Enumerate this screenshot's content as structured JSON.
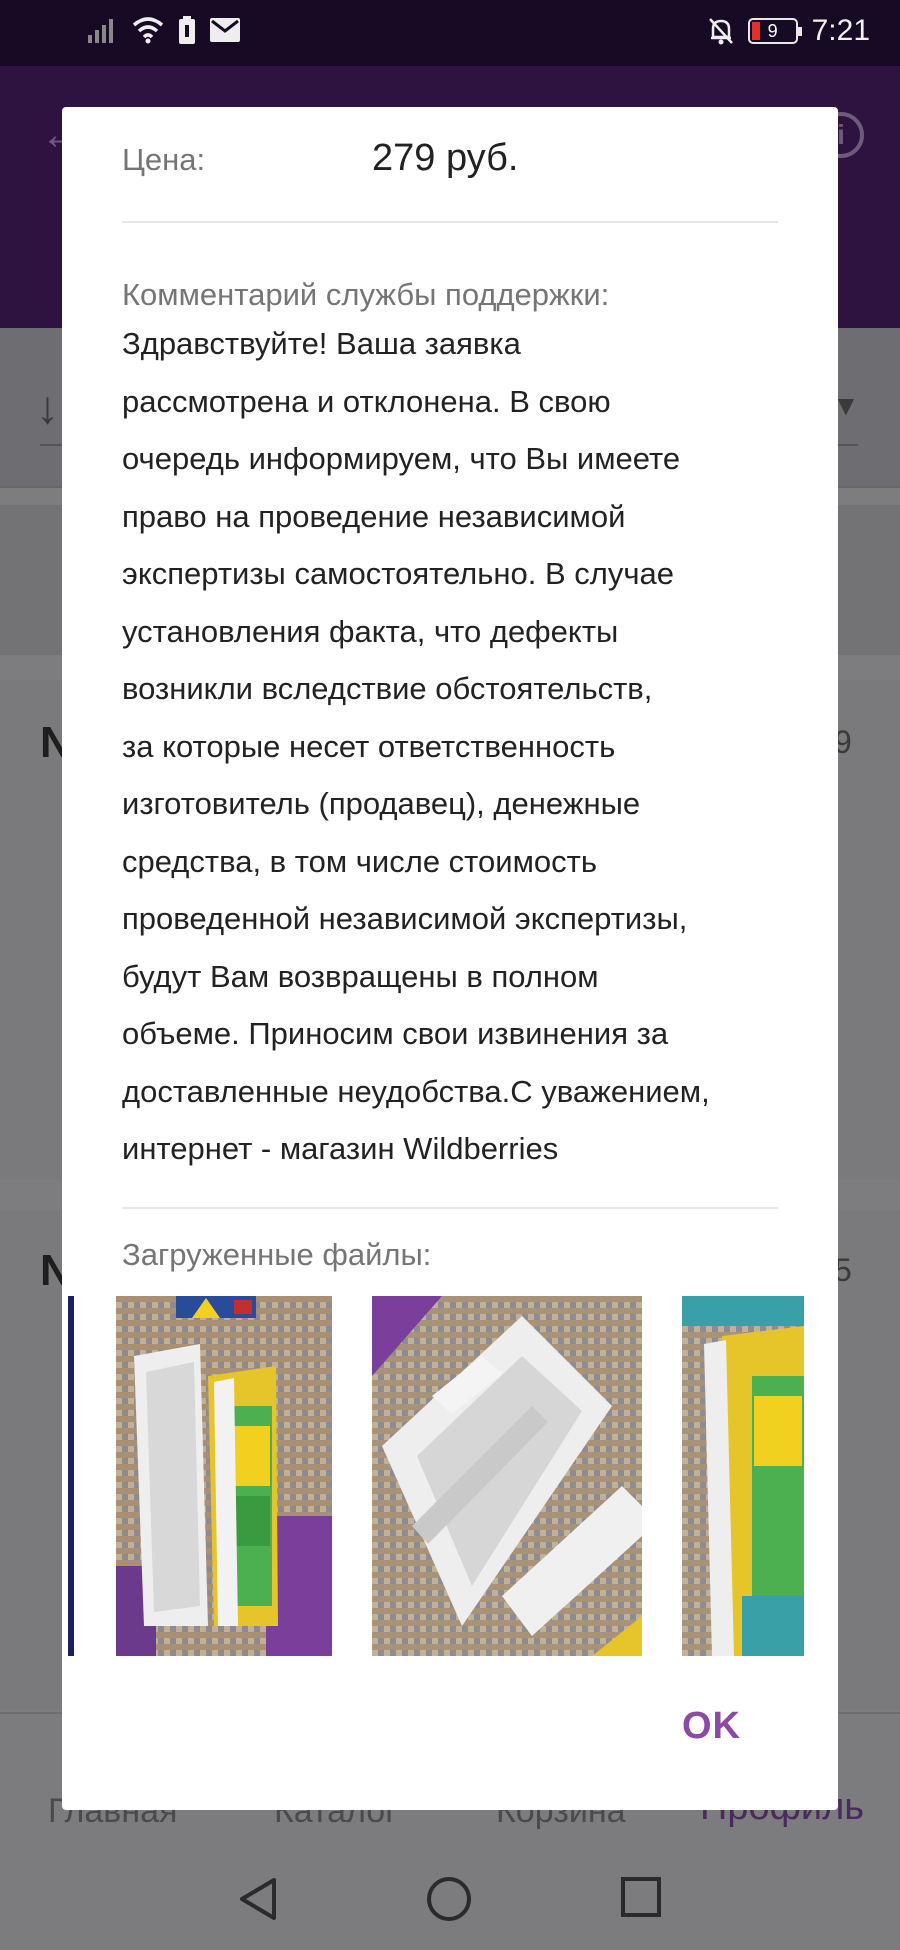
{
  "status_bar": {
    "time": "7:21",
    "battery_level": "9",
    "icons": [
      "signal-icon",
      "wifi-icon",
      "battery-saver-icon",
      "mail-icon",
      "notifications-off-icon",
      "battery-icon"
    ]
  },
  "dialog": {
    "price_label": "Цена:",
    "price_value": "279 руб.",
    "comment_label": "Комментарий службы поддержки:",
    "comment_text": "Здравствуйте! Ваша заявка\nрассмотрена и отклонена. В свою\nочередь информируем, что Вы имеете\nправо на проведение независимой\nэкспертизы самостоятельно. В случае\nустановления факта, что дефекты\nвозникли вследствие обстоятельств,\nза которые несет ответственность\nизготовитель (продавец),  денежные\nсредства, в том числе стоимость\nпроведенной независимой экспертизы,\nбудут Вам возвращены в полном\nобъеме. Приносим свои извинения за\nдоставленные неудобства.С уважением,\nинтернет - магазин Wildberries",
    "files_label": "Загруженные файлы:",
    "ok_label": "OK"
  },
  "background": {
    "card1_title": "N",
    "card1_right": "9",
    "card2_title": "N",
    "card2_right": "5"
  },
  "bottom_nav": {
    "items": [
      "Главная",
      "Каталог",
      "Корзина",
      "Профиль"
    ]
  },
  "colors": {
    "accent": "#8a4aa6",
    "status_bar": "#160a24",
    "header_dimmed": "#2e1240"
  }
}
